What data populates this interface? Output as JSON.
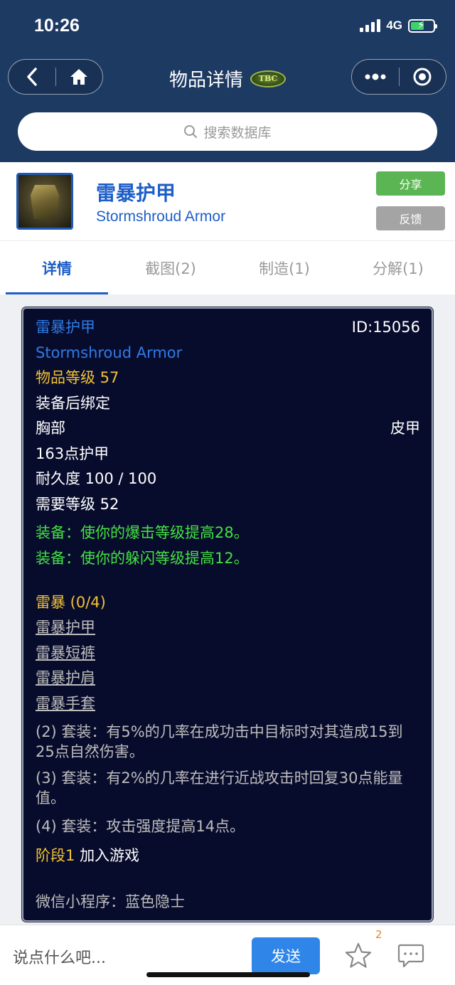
{
  "status": {
    "time": "10:26",
    "network": "4G"
  },
  "nav": {
    "title": "物品详情",
    "logo_text": "TBC"
  },
  "search": {
    "placeholder": "搜索数据库"
  },
  "item": {
    "name_cn": "雷暴护甲",
    "name_en": "Stormshroud Armor",
    "share_label": "分享",
    "feedback_label": "反馈"
  },
  "tabs": [
    "详情",
    "截图(2)",
    "制造(1)",
    "分解(1)"
  ],
  "tooltip": {
    "name_cn": "雷暴护甲",
    "id": "ID:15056",
    "name_en": "Stormshroud Armor",
    "item_level": "物品等级 57",
    "bind": "装备后绑定",
    "slot": "胸部",
    "armor_type": "皮甲",
    "armor": "163点护甲",
    "durability": "耐久度 100 / 100",
    "req_level": "需要等级 52",
    "equip1": "装备：使你的爆击等级提高28。",
    "equip2": "装备：使你的躲闪等级提高12。",
    "set_name": "雷暴 (0/4)",
    "set_items": [
      "雷暴护甲",
      "雷暴短裤",
      "雷暴护肩",
      "雷暴手套"
    ],
    "bonus2": "(2) 套装：有5%的几率在成功击中目标时对其造成15到25点自然伤害。",
    "bonus3": "(3) 套装：有2%的几率在进行近战攻击时回复30点能量值。",
    "bonus4": "(4) 套装：攻击强度提高14点。",
    "phase_label": "阶段1",
    "phase_text": "加入游戏",
    "footer": "微信小程序：蓝色隐士"
  },
  "bottom": {
    "comment_placeholder": "说点什么吧...",
    "send_label": "发送",
    "star_count": "2"
  },
  "colors": {
    "header_bg": "#1d3a63",
    "accent": "#1e5ec8",
    "share": "#5ab552",
    "feedback": "#a4a4a4",
    "tooltip_bg": "#080c2c"
  }
}
